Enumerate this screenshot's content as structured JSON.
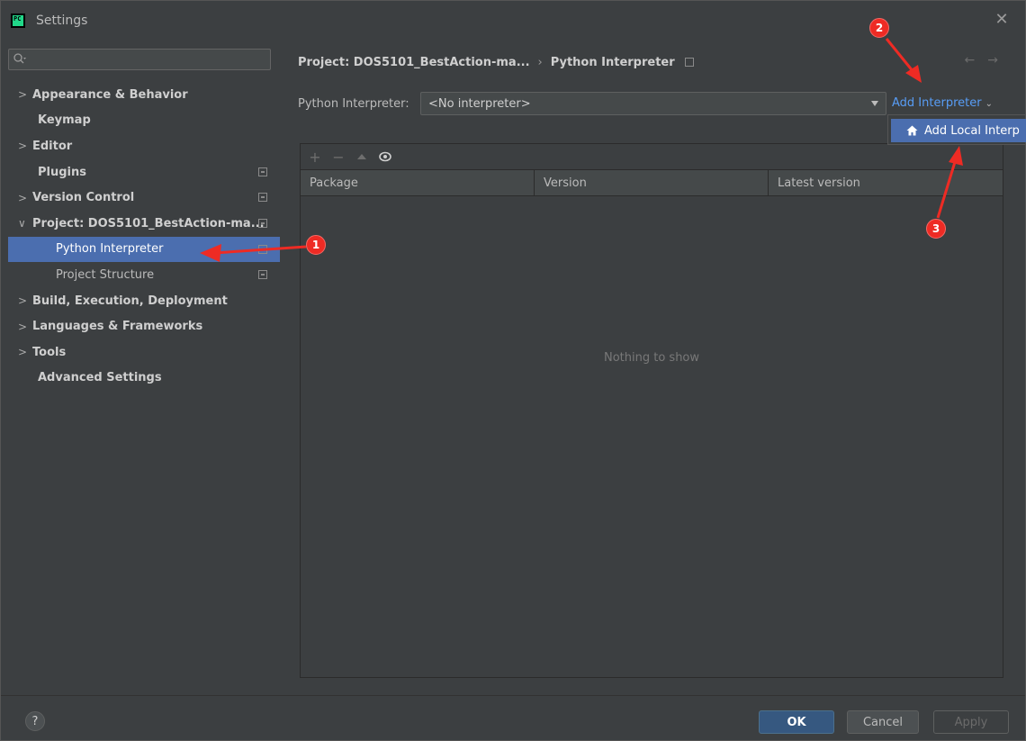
{
  "window": {
    "title": "Settings"
  },
  "sidebar": {
    "search_placeholder": "",
    "items": [
      {
        "label": "Appearance & Behavior",
        "expandable": true,
        "expanded": false,
        "bold": true,
        "badge": false
      },
      {
        "label": "Keymap",
        "expandable": false,
        "bold": true,
        "badge": false
      },
      {
        "label": "Editor",
        "expandable": true,
        "expanded": false,
        "bold": true,
        "badge": false
      },
      {
        "label": "Plugins",
        "expandable": false,
        "bold": true,
        "badge": true
      },
      {
        "label": "Version Control",
        "expandable": true,
        "expanded": false,
        "bold": true,
        "badge": true
      },
      {
        "label": "Project: DOS5101_BestAction-ma...",
        "expandable": true,
        "expanded": true,
        "bold": true,
        "badge": true
      },
      {
        "label": "Python Interpreter",
        "child": true,
        "selected": true,
        "badge": true
      },
      {
        "label": "Project Structure",
        "child": true,
        "badge": true
      },
      {
        "label": "Build, Execution, Deployment",
        "expandable": true,
        "expanded": false,
        "bold": true,
        "badge": false
      },
      {
        "label": "Languages & Frameworks",
        "expandable": true,
        "expanded": false,
        "bold": true,
        "badge": false
      },
      {
        "label": "Tools",
        "expandable": true,
        "expanded": false,
        "bold": true,
        "badge": false
      },
      {
        "label": "Advanced Settings",
        "expandable": false,
        "bold": true,
        "badge": false
      }
    ]
  },
  "breadcrumb": {
    "project": "Project: DOS5101_BestAction-ma...",
    "separator": "›",
    "page": "Python Interpreter"
  },
  "interpreter": {
    "label": "Python Interpreter:",
    "value": "<No interpreter>",
    "add_label": "Add Interpreter",
    "popup_item": "Add Local Interp"
  },
  "packages": {
    "columns": [
      "Package",
      "Version",
      "Latest version"
    ],
    "empty_text": "Nothing to show",
    "toolbar": [
      "add-icon",
      "remove-icon",
      "upgrade-icon",
      "eye-icon"
    ]
  },
  "footer": {
    "help": "?",
    "ok": "OK",
    "cancel": "Cancel",
    "apply": "Apply"
  },
  "annotations": [
    "1",
    "2",
    "3"
  ],
  "colors": {
    "accent": "#4b6eaf",
    "link": "#589df6",
    "annotation": "#ee2b24",
    "background": "#3c3f41"
  }
}
